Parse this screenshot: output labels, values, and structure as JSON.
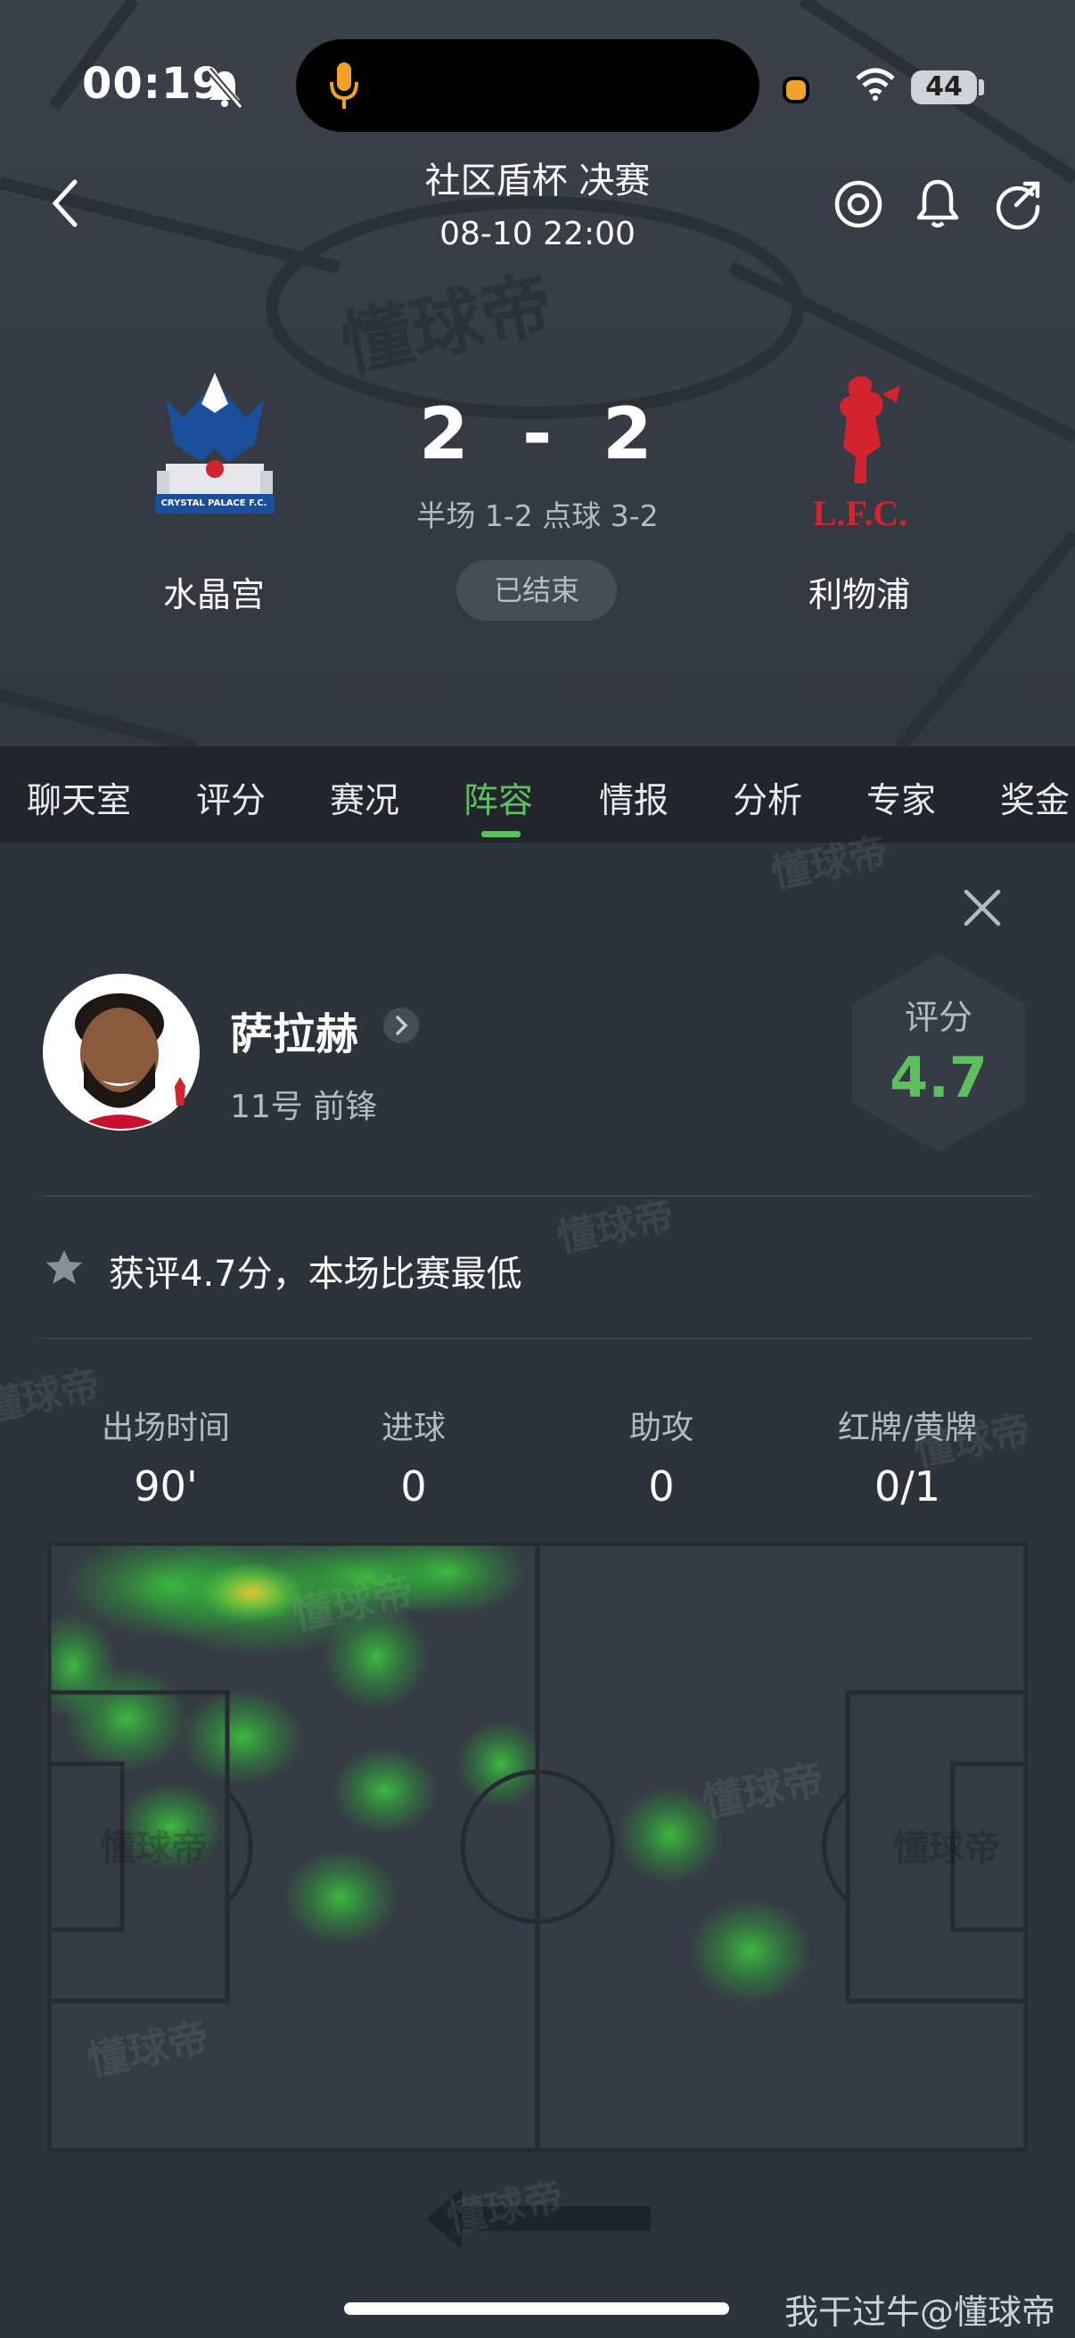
{
  "status_bar": {
    "time": "00:19",
    "battery": "44",
    "icons": [
      "bell-muted-icon",
      "mic-icon",
      "wifi-icon",
      "battery-icon"
    ]
  },
  "match": {
    "competition": "社区盾杯 决赛",
    "datetime": "08-10 22:00",
    "home_team": "水晶宫",
    "away_team": "利物浦",
    "home_score": "2",
    "away_score": "2",
    "separator": "-",
    "details": "半场 1-2 点球 3-2",
    "status": "已结束",
    "home_logo_text": "CRYSTAL PALACE F.C.",
    "away_logo_text": "L.F.C."
  },
  "tabs": [
    {
      "label": "聊天室"
    },
    {
      "label": "评分"
    },
    {
      "label": "赛况"
    },
    {
      "label": "阵容",
      "active": true
    },
    {
      "label": "情报"
    },
    {
      "label": "分析"
    },
    {
      "label": "专家"
    },
    {
      "label": "奖金"
    }
  ],
  "player": {
    "name": "萨拉赫",
    "info": "11号 前锋",
    "rating_label": "评分",
    "rating": "4.7",
    "note": "获评4.7分，本场比赛最低"
  },
  "stats": [
    {
      "label": "出场时间",
      "value": "90'"
    },
    {
      "label": "进球",
      "value": "0"
    },
    {
      "label": "助攻",
      "value": "0"
    },
    {
      "label": "红牌/黄牌",
      "value": "0/1"
    }
  ],
  "watermark": "懂球帝",
  "footer": {
    "credit": "我干过牛@懂球帝"
  },
  "colors": {
    "accent": "#5fbf5f",
    "background": "#2d333b",
    "tabbar": "#22262c",
    "liverpool_red": "#d3232e",
    "palace_blue": "#1b4f9c"
  }
}
